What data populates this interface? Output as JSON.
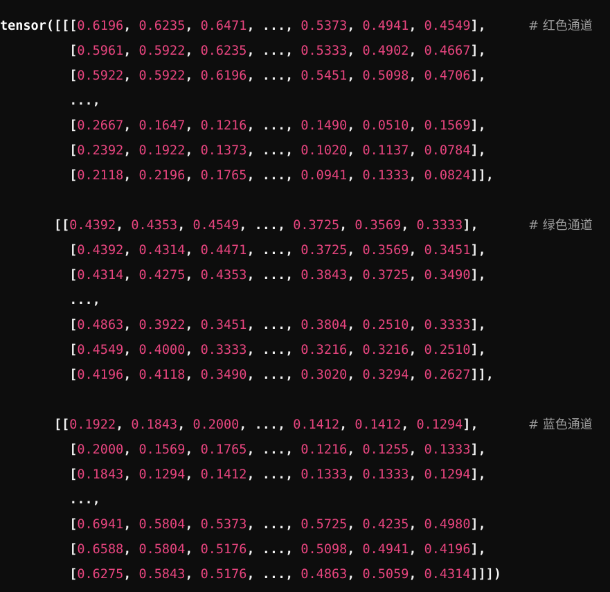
{
  "theme": {
    "background": "#0d0d0d",
    "text": "#f2f2f2",
    "number": "#e8457f",
    "comment": "#9a9a9a"
  },
  "code": {
    "prefix": "tensor(",
    "ellipsis": "...",
    "channels": [
      {
        "comment": "# 红色通道",
        "rows": [
          [
            "0.6196",
            "0.6235",
            "0.6471",
            "0.5373",
            "0.4941",
            "0.4549"
          ],
          [
            "0.5961",
            "0.5922",
            "0.6235",
            "0.5333",
            "0.4902",
            "0.4667"
          ],
          [
            "0.5922",
            "0.5922",
            "0.6196",
            "0.5451",
            "0.5098",
            "0.4706"
          ],
          [
            "0.2667",
            "0.1647",
            "0.1216",
            "0.1490",
            "0.0510",
            "0.1569"
          ],
          [
            "0.2392",
            "0.1922",
            "0.1373",
            "0.1020",
            "0.1137",
            "0.0784"
          ],
          [
            "0.2118",
            "0.2196",
            "0.1765",
            "0.0941",
            "0.1333",
            "0.0824"
          ]
        ]
      },
      {
        "comment": "# 绿色通道",
        "rows": [
          [
            "0.4392",
            "0.4353",
            "0.4549",
            "0.3725",
            "0.3569",
            "0.3333"
          ],
          [
            "0.4392",
            "0.4314",
            "0.4471",
            "0.3725",
            "0.3569",
            "0.3451"
          ],
          [
            "0.4314",
            "0.4275",
            "0.4353",
            "0.3843",
            "0.3725",
            "0.3490"
          ],
          [
            "0.4863",
            "0.3922",
            "0.3451",
            "0.3804",
            "0.2510",
            "0.3333"
          ],
          [
            "0.4549",
            "0.4000",
            "0.3333",
            "0.3216",
            "0.3216",
            "0.2510"
          ],
          [
            "0.4196",
            "0.4118",
            "0.3490",
            "0.3020",
            "0.3294",
            "0.2627"
          ]
        ]
      },
      {
        "comment": "# 蓝色通道",
        "rows": [
          [
            "0.1922",
            "0.1843",
            "0.2000",
            "0.1412",
            "0.1412",
            "0.1294"
          ],
          [
            "0.2000",
            "0.1569",
            "0.1765",
            "0.1216",
            "0.1255",
            "0.1333"
          ],
          [
            "0.1843",
            "0.1294",
            "0.1412",
            "0.1333",
            "0.1333",
            "0.1294"
          ],
          [
            "0.6941",
            "0.5804",
            "0.5373",
            "0.5725",
            "0.4235",
            "0.4980"
          ],
          [
            "0.6588",
            "0.5804",
            "0.5176",
            "0.5098",
            "0.4941",
            "0.4196"
          ],
          [
            "0.6275",
            "0.5843",
            "0.5176",
            "0.4863",
            "0.5059",
            "0.4314"
          ]
        ]
      }
    ]
  }
}
